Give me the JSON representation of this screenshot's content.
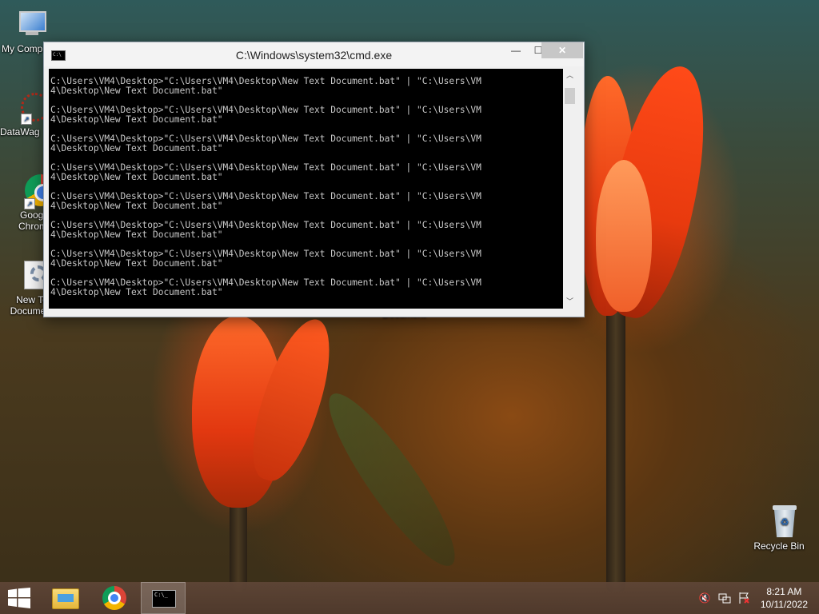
{
  "desktop": {
    "icons": [
      {
        "label": "My Comp"
      },
      {
        "label": "DataWag"
      },
      {
        "label": "Googl Chrom"
      },
      {
        "label": "New Te Document"
      },
      {
        "label": "Recycle Bin"
      }
    ],
    "hidden_label": "Document"
  },
  "cmd_window": {
    "title": "C:\\Windows\\system32\\cmd.exe",
    "minimize_glyph": "—",
    "maximize_glyph": "☐",
    "close_glyph": "✕",
    "lines": [
      "C:\\Users\\VM4\\Desktop>\"C:\\Users\\VM4\\Desktop\\New Text Document.bat\" | \"C:\\Users\\VM",
      "4\\Desktop\\New Text Document.bat\"",
      "",
      "C:\\Users\\VM4\\Desktop>\"C:\\Users\\VM4\\Desktop\\New Text Document.bat\" | \"C:\\Users\\VM",
      "4\\Desktop\\New Text Document.bat\"",
      "",
      "C:\\Users\\VM4\\Desktop>\"C:\\Users\\VM4\\Desktop\\New Text Document.bat\" | \"C:\\Users\\VM",
      "4\\Desktop\\New Text Document.bat\"",
      "",
      "C:\\Users\\VM4\\Desktop>\"C:\\Users\\VM4\\Desktop\\New Text Document.bat\" | \"C:\\Users\\VM",
      "4\\Desktop\\New Text Document.bat\"",
      "",
      "C:\\Users\\VM4\\Desktop>\"C:\\Users\\VM4\\Desktop\\New Text Document.bat\" | \"C:\\Users\\VM",
      "4\\Desktop\\New Text Document.bat\"",
      "",
      "C:\\Users\\VM4\\Desktop>\"C:\\Users\\VM4\\Desktop\\New Text Document.bat\" | \"C:\\Users\\VM",
      "4\\Desktop\\New Text Document.bat\"",
      "",
      "C:\\Users\\VM4\\Desktop>\"C:\\Users\\VM4\\Desktop\\New Text Document.bat\" | \"C:\\Users\\VM",
      "4\\Desktop\\New Text Document.bat\"",
      "",
      "C:\\Users\\VM4\\Desktop>\"C:\\Users\\VM4\\Desktop\\New Text Document.bat\" | \"C:\\Users\\VM",
      "4\\Desktop\\New Text Document.bat\""
    ]
  },
  "taskbar": {
    "buttons": [
      {
        "icon": "windows-start-icon"
      },
      {
        "icon": "file-explorer-icon"
      },
      {
        "icon": "chrome-icon"
      },
      {
        "icon": "cmd-icon"
      }
    ],
    "tray": [
      {
        "icon": "volume-muted-icon"
      },
      {
        "icon": "network-icon"
      },
      {
        "icon": "action-center-flag-icon"
      }
    ],
    "time": "8:21 AM",
    "date": "10/11/2022"
  },
  "colors": {
    "console_bg": "#000000",
    "console_text": "#c8c8c8",
    "close_button": "#c7c7c7"
  }
}
